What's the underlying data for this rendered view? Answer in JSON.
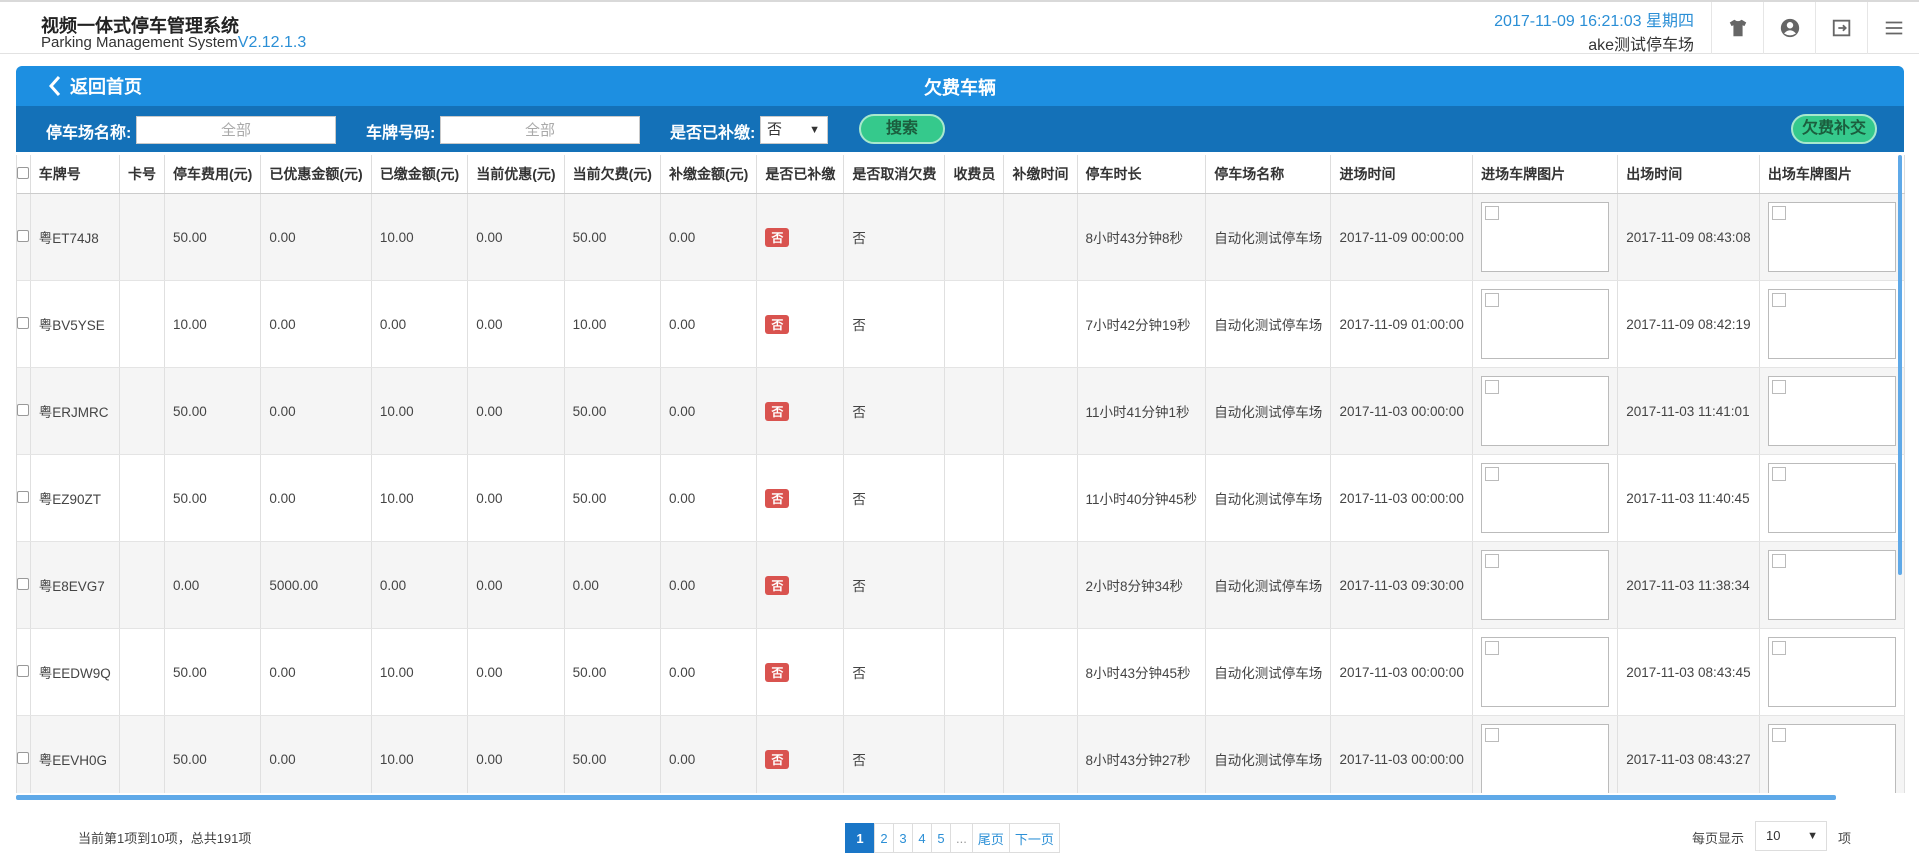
{
  "header": {
    "title_cn": "视频一体式停车管理系统",
    "title_en": "Parking Management System",
    "version": "V2.12.1.3",
    "datetime": "2017-11-09 16:21:03 星期四",
    "lot_name": "ake测试停车场",
    "icons": [
      "shirt-icon",
      "user-icon",
      "logout-icon",
      "menu-icon"
    ]
  },
  "panel": {
    "back_label": "返回首页",
    "title": "欠费车辆"
  },
  "filters": {
    "lot_label": "停车场名称:",
    "lot_placeholder": "全部",
    "plate_label": "车牌号码:",
    "plate_placeholder": "全部",
    "paid_label": "是否已补缴:",
    "paid_value": "否",
    "search_label": "搜索",
    "supplement_label": "欠费补交"
  },
  "table": {
    "columns": [
      "车牌号",
      "卡号",
      "停车费用(元)",
      "已优惠金额(元)",
      "已缴金额(元)",
      "当前优惠(元)",
      "当前欠费(元)",
      "补缴金额(元)",
      "是否已补缴",
      "是否取消欠费",
      "收费员",
      "补缴时间",
      "停车时长",
      "停车场名称",
      "进场时间",
      "进场车牌图片",
      "出场时间",
      "出场车牌图片"
    ],
    "rows": [
      {
        "plate": "粤ET74J8",
        "card": "",
        "fee": "50.00",
        "discounted": "0.00",
        "paid": "10.00",
        "cur_discount": "0.00",
        "arrears": "50.00",
        "supplement": "0.00",
        "is_paid": "否",
        "is_cancel": "否",
        "cashier": "",
        "supp_time": "",
        "duration": "8小时43分钟8秒",
        "lot": "自动化测试停车场",
        "entry_time": "2017-11-09 00:00:00",
        "exit_time": "2017-11-09 08:43:08"
      },
      {
        "plate": "粤BV5YSE",
        "card": "",
        "fee": "10.00",
        "discounted": "0.00",
        "paid": "0.00",
        "cur_discount": "0.00",
        "arrears": "10.00",
        "supplement": "0.00",
        "is_paid": "否",
        "is_cancel": "否",
        "cashier": "",
        "supp_time": "",
        "duration": "7小时42分钟19秒",
        "lot": "自动化测试停车场",
        "entry_time": "2017-11-09 01:00:00",
        "exit_time": "2017-11-09 08:42:19"
      },
      {
        "plate": "粤ERJMRC",
        "card": "",
        "fee": "50.00",
        "discounted": "0.00",
        "paid": "10.00",
        "cur_discount": "0.00",
        "arrears": "50.00",
        "supplement": "0.00",
        "is_paid": "否",
        "is_cancel": "否",
        "cashier": "",
        "supp_time": "",
        "duration": "11小时41分钟1秒",
        "lot": "自动化测试停车场",
        "entry_time": "2017-11-03 00:00:00",
        "exit_time": "2017-11-03 11:41:01"
      },
      {
        "plate": "粤EZ90ZT",
        "card": "",
        "fee": "50.00",
        "discounted": "0.00",
        "paid": "10.00",
        "cur_discount": "0.00",
        "arrears": "50.00",
        "supplement": "0.00",
        "is_paid": "否",
        "is_cancel": "否",
        "cashier": "",
        "supp_time": "",
        "duration": "11小时40分钟45秒",
        "lot": "自动化测试停车场",
        "entry_time": "2017-11-03 00:00:00",
        "exit_time": "2017-11-03 11:40:45"
      },
      {
        "plate": "粤E8EVG7",
        "card": "",
        "fee": "0.00",
        "discounted": "5000.00",
        "paid": "0.00",
        "cur_discount": "0.00",
        "arrears": "0.00",
        "supplement": "0.00",
        "is_paid": "否",
        "is_cancel": "否",
        "cashier": "",
        "supp_time": "",
        "duration": "2小时8分钟34秒",
        "lot": "自动化测试停车场",
        "entry_time": "2017-11-03 09:30:00",
        "exit_time": "2017-11-03 11:38:34"
      },
      {
        "plate": "粤EEDW9Q",
        "card": "",
        "fee": "50.00",
        "discounted": "0.00",
        "paid": "10.00",
        "cur_discount": "0.00",
        "arrears": "50.00",
        "supplement": "0.00",
        "is_paid": "否",
        "is_cancel": "否",
        "cashier": "",
        "supp_time": "",
        "duration": "8小时43分钟45秒",
        "lot": "自动化测试停车场",
        "entry_time": "2017-11-03 00:00:00",
        "exit_time": "2017-11-03 08:43:45"
      },
      {
        "plate": "粤EEVH0G",
        "card": "",
        "fee": "50.00",
        "discounted": "0.00",
        "paid": "10.00",
        "cur_discount": "0.00",
        "arrears": "50.00",
        "supplement": "0.00",
        "is_paid": "否",
        "is_cancel": "否",
        "cashier": "",
        "supp_time": "",
        "duration": "8小时43分钟27秒",
        "lot": "自动化测试停车场",
        "entry_time": "2017-11-03 00:00:00",
        "exit_time": "2017-11-03 08:43:27"
      }
    ]
  },
  "footer": {
    "info": "当前第1项到10项，总共191项",
    "pages": [
      "1",
      "2",
      "3",
      "4",
      "5",
      "..."
    ],
    "last_label": "尾页",
    "next_label": "下一页",
    "per_page_label": "每页显示",
    "per_page_value": "10",
    "per_page_suffix": "项"
  },
  "colors": {
    "header_blue": "#1d8fe1",
    "filter_blue": "#1471b8",
    "accent_green": "#35c98c",
    "badge_red": "#d9534f",
    "link_blue": "#2b8fd6"
  }
}
